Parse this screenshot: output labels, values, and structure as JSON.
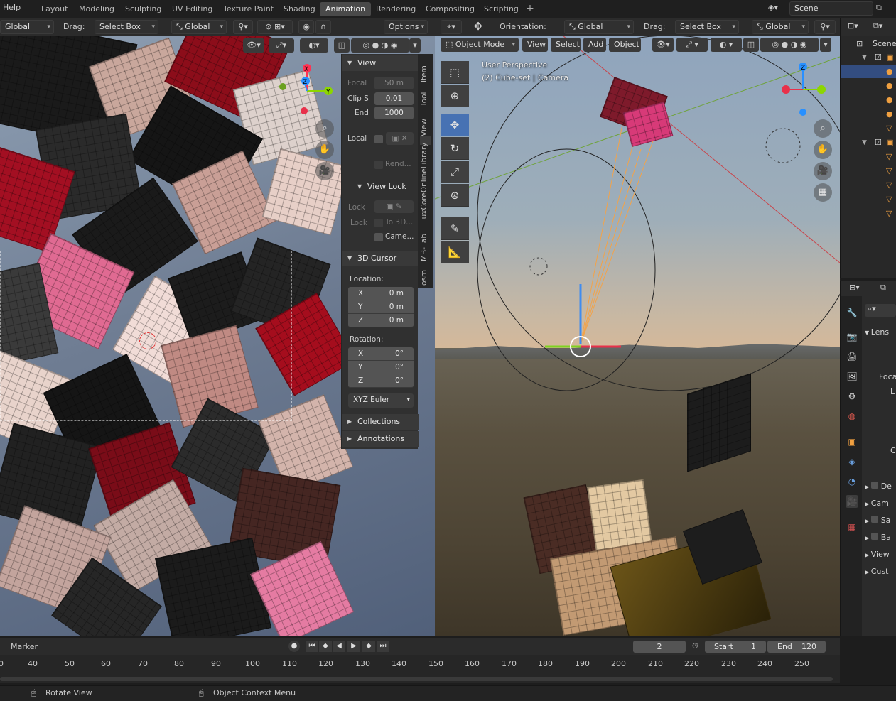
{
  "topbar": {
    "help": "Help",
    "tabs": [
      "Layout",
      "Modeling",
      "Sculpting",
      "UV Editing",
      "Texture Paint",
      "Shading",
      "Animation",
      "Rendering",
      "Compositing",
      "Scripting"
    ],
    "active_tab": "Animation",
    "scene": "Scene"
  },
  "left_header": {
    "transform": "Global",
    "drag_label": "Drag:",
    "drag_value": "Select Box",
    "orientation": "Global",
    "options": "Options"
  },
  "right_header": {
    "orientation_label": "Orientation:",
    "orientation": "Global",
    "drag_label": "Drag:",
    "drag_value": "Select Box",
    "pivot": "Global",
    "mode": "Object Mode",
    "menu": [
      "View",
      "Select",
      "Add",
      "Object"
    ]
  },
  "npanel": {
    "tabs": [
      "Item",
      "Tool",
      "View",
      "LuxCoreOnlineLibrary",
      "MB-Lab",
      "osm"
    ],
    "view_title": "View",
    "focal_label": "Focal",
    "focal_value": "50 m",
    "clip_start_label": "Clip S",
    "clip_start_value": "0.01",
    "clip_end_label": "End",
    "clip_end_value": "1000",
    "local_label": "Local",
    "render_label": "Rend...",
    "viewlock_title": "View Lock",
    "lock_label": "Lock",
    "lock_to3d_label": "Lock",
    "to3d": "To 3D...",
    "camera": "Came...",
    "cursor_title": "3D Cursor",
    "location_label": "Location:",
    "location": [
      {
        "k": "X",
        "v": "0 m"
      },
      {
        "k": "Y",
        "v": "0 m"
      },
      {
        "k": "Z",
        "v": "0 m"
      }
    ],
    "rotation_label": "Rotation:",
    "rotation": [
      {
        "k": "X",
        "v": "0°"
      },
      {
        "k": "Y",
        "v": "0°"
      },
      {
        "k": "Z",
        "v": "0°"
      }
    ],
    "rotation_mode": "XYZ Euler",
    "collections": "Collections",
    "annotations": "Annotations"
  },
  "viewport_right": {
    "line1": "User Perspective",
    "line2": "(2) Cube-set | Camera"
  },
  "outliner": {
    "title": "Scene"
  },
  "properties": {
    "rows": [
      "Lens",
      "Foca",
      "L",
      "C",
      "De",
      "Cam",
      "Sa",
      "Ba",
      "View",
      "Cust"
    ]
  },
  "timeline": {
    "marker": "Marker",
    "current_frame": "2",
    "start_label": "Start",
    "start_value": "1",
    "end_label": "End",
    "end_value": "120",
    "ticks": [
      "0",
      "40",
      "50",
      "60",
      "70",
      "80",
      "90",
      "100",
      "110",
      "120",
      "130",
      "140",
      "150",
      "160",
      "170",
      "180",
      "190",
      "200",
      "210",
      "220",
      "230",
      "240",
      "250"
    ]
  },
  "statusbar": {
    "left": "Rotate View",
    "middle": "Object Context Menu"
  },
  "colors": {
    "accent": "#4772b3",
    "active_tab": "#4a4a4a"
  }
}
